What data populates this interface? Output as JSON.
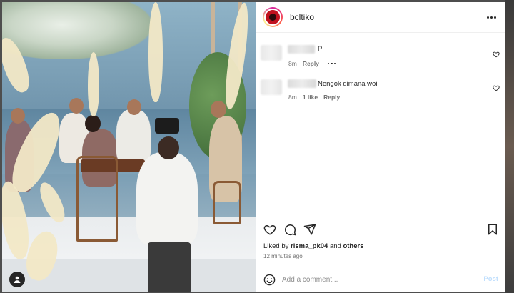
{
  "post": {
    "username": "bcltiko",
    "more_icon": "more-horizontal-icon"
  },
  "comments": [
    {
      "text": "P",
      "time": "8m",
      "likes": "",
      "reply": "Reply",
      "has_more": true
    },
    {
      "text": "Nengok dimana woii",
      "time": "8m",
      "likes": "1 like",
      "reply": "Reply",
      "has_more": false
    }
  ],
  "likes": {
    "prefix": "Liked by",
    "user": "risma_pk04",
    "joiner": "and",
    "others": "others"
  },
  "timestamp": "12 minutes ago",
  "comment_box": {
    "placeholder": "Add a comment...",
    "post_label": "Post"
  },
  "colors": {
    "text": "#262626",
    "muted": "#737373",
    "post_disabled": "#c0dffd",
    "avatar_ring": "#d6249f"
  }
}
